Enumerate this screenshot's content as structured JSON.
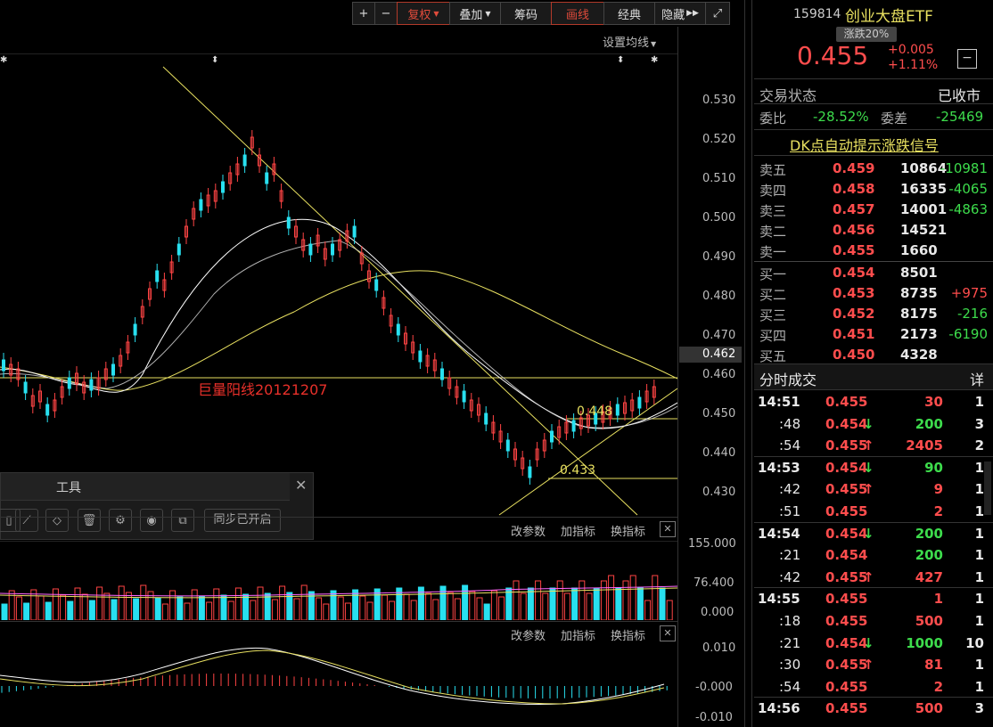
{
  "toolbar": {
    "plus": "+",
    "minus": "−",
    "fuquan": "复权",
    "diejia": "叠加",
    "chouma": "筹码",
    "huaxian": "画线",
    "jingdian": "经典",
    "yincang": "隐藏",
    "expand": "⤢"
  },
  "chart": {
    "ma_setting": "设置均线",
    "price_axis": [
      "0.530",
      "0.520",
      "0.510",
      "0.500",
      "0.490",
      "0.480",
      "0.470",
      "0.460",
      "0.450",
      "0.440",
      "0.430"
    ],
    "current_price_tag": "0.462",
    "annotation": "巨量阳线20121207",
    "label_448": "0.448",
    "label_433": "0.433",
    "vol_axis": [
      "155.000",
      "76.400",
      "0.000"
    ],
    "macd_axis": [
      "0.010",
      "-0.000",
      "-0.010"
    ],
    "panel_buttons": [
      "改参数",
      "加指标",
      "换指标"
    ],
    "close_x": "✕"
  },
  "tool_panel": {
    "title": "工具",
    "sync_label": "同步已开启"
  },
  "quote": {
    "code": "159814",
    "name": "创业大盘ETF",
    "limit_tag": "涨跌20%",
    "price": "0.455",
    "change": "+0.005",
    "change_pct": "+1.11%",
    "minus_btn": "−",
    "trade_status_label": "交易状态",
    "trade_status_value": "已收市",
    "weibi_label": "委比",
    "weibi_value": "-28.52%",
    "weicha_label": "委差",
    "weicha_value": "-25469",
    "dk_link": "DK点自动提示涨跌信号"
  },
  "order_book": [
    {
      "label": "卖五",
      "price": "0.459",
      "vol": "10864",
      "chg": "-10981",
      "chg_color": "green"
    },
    {
      "label": "卖四",
      "price": "0.458",
      "vol": "16335",
      "chg": "-4065",
      "chg_color": "green"
    },
    {
      "label": "卖三",
      "price": "0.457",
      "vol": "14001",
      "chg": "-4863",
      "chg_color": "green"
    },
    {
      "label": "卖二",
      "price": "0.456",
      "vol": "14521",
      "chg": "",
      "chg_color": "green"
    },
    {
      "label": "卖一",
      "price": "0.455",
      "vol": "1660",
      "chg": "",
      "chg_color": "green"
    },
    {
      "label": "买一",
      "price": "0.454",
      "vol": "8501",
      "chg": "",
      "chg_color": "green"
    },
    {
      "label": "买二",
      "price": "0.453",
      "vol": "8735",
      "chg": "+975",
      "chg_color": "red"
    },
    {
      "label": "买三",
      "price": "0.452",
      "vol": "8175",
      "chg": "-216",
      "chg_color": "green"
    },
    {
      "label": "买四",
      "price": "0.451",
      "vol": "2173",
      "chg": "-6190",
      "chg_color": "green"
    },
    {
      "label": "买五",
      "price": "0.450",
      "vol": "4328",
      "chg": "",
      "chg_color": "green"
    }
  ],
  "ticks_header": {
    "title": "分时成交",
    "detail": "详"
  },
  "ticks": [
    {
      "time": "14:51",
      "price": "0.455",
      "dir": "",
      "vol": "30",
      "vol_color": "red",
      "n": "1",
      "bold": true
    },
    {
      "time": ":48",
      "price": "0.454",
      "dir": "down",
      "vol": "200",
      "vol_color": "green",
      "n": "3",
      "bold": false
    },
    {
      "time": ":54",
      "price": "0.455",
      "dir": "up",
      "vol": "2405",
      "vol_color": "red",
      "n": "2",
      "bold": false
    },
    {
      "time": "14:53",
      "price": "0.454",
      "dir": "down",
      "vol": "90",
      "vol_color": "green",
      "n": "1",
      "bold": true
    },
    {
      "time": ":42",
      "price": "0.455",
      "dir": "up",
      "vol": "9",
      "vol_color": "red",
      "n": "1",
      "bold": false
    },
    {
      "time": ":51",
      "price": "0.455",
      "dir": "",
      "vol": "2",
      "vol_color": "red",
      "n": "1",
      "bold": false
    },
    {
      "time": "14:54",
      "price": "0.454",
      "dir": "down",
      "vol": "200",
      "vol_color": "green",
      "n": "1",
      "bold": true
    },
    {
      "time": ":21",
      "price": "0.454",
      "dir": "",
      "vol": "200",
      "vol_color": "green",
      "n": "1",
      "bold": false
    },
    {
      "time": ":42",
      "price": "0.455",
      "dir": "up",
      "vol": "427",
      "vol_color": "red",
      "n": "1",
      "bold": false
    },
    {
      "time": "14:55",
      "price": "0.455",
      "dir": "",
      "vol": "1",
      "vol_color": "red",
      "n": "1",
      "bold": true
    },
    {
      "time": ":18",
      "price": "0.455",
      "dir": "",
      "vol": "500",
      "vol_color": "red",
      "n": "1",
      "bold": false
    },
    {
      "time": ":21",
      "price": "0.454",
      "dir": "down",
      "vol": "1000",
      "vol_color": "green",
      "n": "10",
      "bold": false
    },
    {
      "time": ":30",
      "price": "0.455",
      "dir": "up",
      "vol": "81",
      "vol_color": "red",
      "n": "1",
      "bold": false
    },
    {
      "time": ":54",
      "price": "0.455",
      "dir": "",
      "vol": "2",
      "vol_color": "red",
      "n": "1",
      "bold": false
    },
    {
      "time": "14:56",
      "price": "0.455",
      "dir": "",
      "vol": "500",
      "vol_color": "red",
      "n": "3",
      "bold": true
    }
  ]
}
